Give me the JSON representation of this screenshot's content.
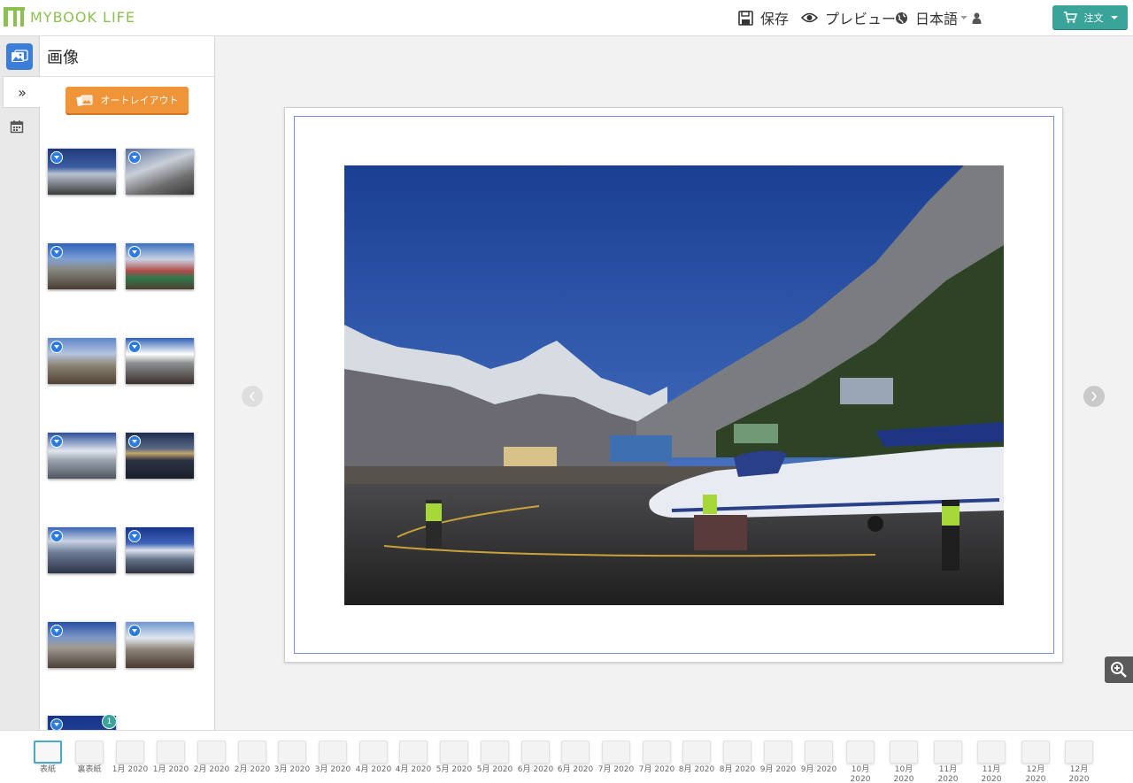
{
  "app": {
    "logo_text": "MYBOOK LIFE"
  },
  "header": {
    "save_label": "保存",
    "preview_label": "プレビュー",
    "language_label": "日本語",
    "order_label": "注文"
  },
  "panel": {
    "title": "画像",
    "auto_layout_label": "オートレイアウト",
    "partial_thumb_badge": "1"
  },
  "colors": {
    "accent": "#3aa39a",
    "brand": "#8cc152",
    "auto_layout": "#f0943a",
    "rail_active": "#3b7dd8",
    "page_guide": "#7d8fd8"
  },
  "icons": [
    "save-icon",
    "eye-icon",
    "globe-icon",
    "user-icon",
    "cart-icon",
    "images-icon",
    "double-chevron-right-icon",
    "calendar-icon",
    "chevron-left-icon",
    "chevron-right-icon",
    "zoom-in-icon"
  ],
  "pages": [
    {
      "label": "表紙"
    },
    {
      "label": "裏表紙"
    },
    {
      "label": "1月 2020"
    },
    {
      "label": "1月 2020"
    },
    {
      "label": "2月 2020"
    },
    {
      "label": "2月 2020"
    },
    {
      "label": "3月 2020"
    },
    {
      "label": "3月 2020"
    },
    {
      "label": "4月 2020"
    },
    {
      "label": "4月 2020"
    },
    {
      "label": "5月 2020"
    },
    {
      "label": "5月 2020"
    },
    {
      "label": "6月 2020"
    },
    {
      "label": "6月 2020"
    },
    {
      "label": "7月 2020"
    },
    {
      "label": "7月 2020"
    },
    {
      "label": "8月 2020"
    },
    {
      "label": "8月 2020"
    },
    {
      "label": "9月 2020"
    },
    {
      "label": "9月 2020"
    },
    {
      "label": "10月\n2020"
    },
    {
      "label": "10月\n2020"
    },
    {
      "label": "11月\n2020"
    },
    {
      "label": "11月\n2020"
    },
    {
      "label": "12月\n2020"
    },
    {
      "label": "12月\n2020"
    }
  ]
}
